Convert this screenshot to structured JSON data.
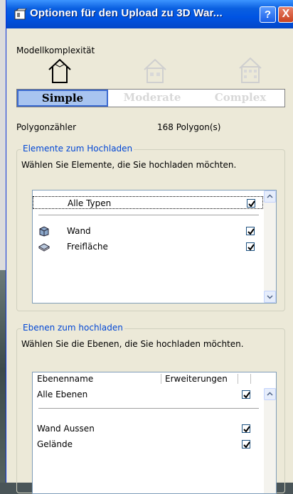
{
  "window": {
    "title": "Optionen für den Upload zu 3D War..."
  },
  "titlebar": {
    "help_label": "?",
    "close_label": "X"
  },
  "complexity": {
    "label": "Modellkomplexität",
    "options": [
      {
        "label": "Simple",
        "selected": true
      },
      {
        "label": "Moderate",
        "selected": false
      },
      {
        "label": "Complex",
        "selected": false
      }
    ]
  },
  "polygon_count": {
    "label": "Polygonzähler",
    "value": "168  Polygon(s)"
  },
  "elements": {
    "legend": "Elemente zum Hochladen",
    "description": "Wählen Sie Elemente, die Sie hochladen möchten.",
    "all_row": {
      "label": "Alle Typen",
      "checked": true
    },
    "items": [
      {
        "label": "Wand",
        "icon": "wall-icon",
        "checked": true
      },
      {
        "label": "Freifläche",
        "icon": "surface-icon",
        "checked": true
      }
    ]
  },
  "layers": {
    "legend": "Ebenen zum hochladen",
    "description": "Wählen Sie die Ebenen, die Sie hochladen möchten.",
    "columns": [
      "Ebenenname",
      "Erweiterungen"
    ],
    "all_row": {
      "label": "Alle Ebenen",
      "checked": true
    },
    "items": [
      {
        "label": "Wand Aussen",
        "checked": true
      },
      {
        "label": "Gelände",
        "checked": true
      }
    ]
  },
  "colors": {
    "titlebar": "#0054e3",
    "dialog_bg": "#ece9d8",
    "legend": "#0046d5",
    "selected_tab": "#a8c4f0"
  }
}
